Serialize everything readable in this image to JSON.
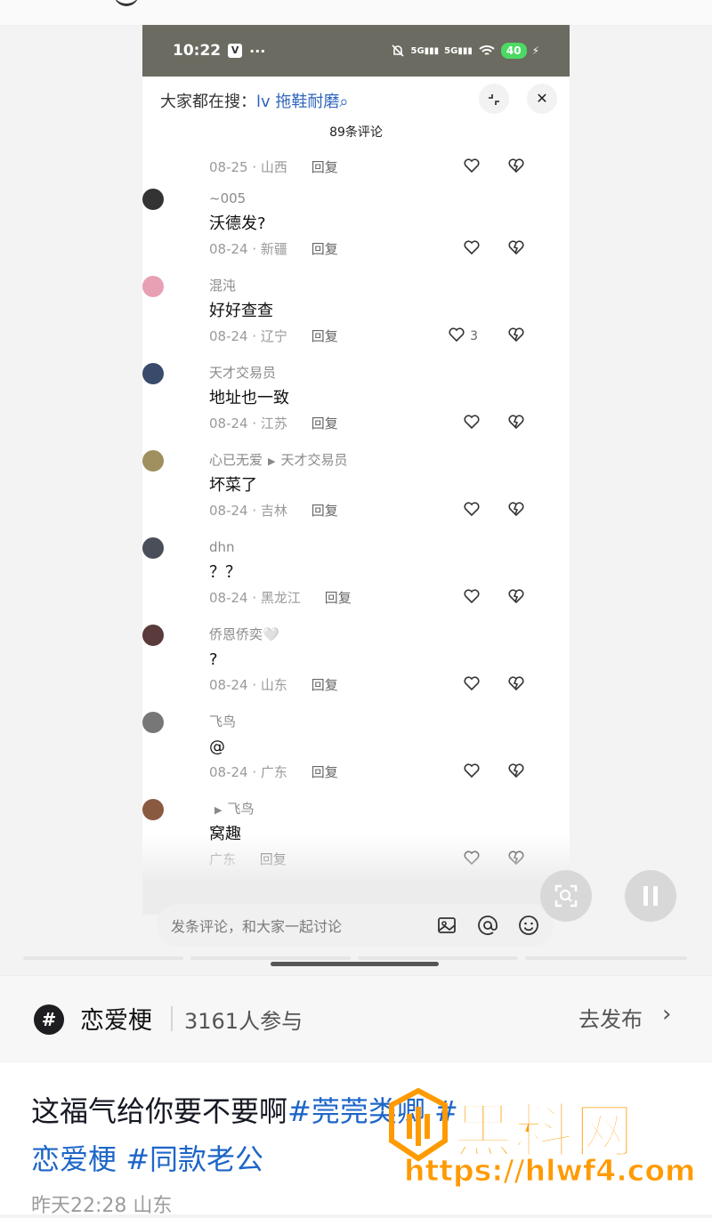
{
  "status_bar": {
    "time": "10:22",
    "app_badge": "V",
    "dots": "···",
    "network": "5G",
    "battery": "40"
  },
  "sheet": {
    "search_prefix": "大家都在搜：",
    "search_keyword": "lv 拖鞋耐磨",
    "comment_count_title": "89条评论"
  },
  "comments": [
    {
      "user": "",
      "text": "",
      "date": "08-25",
      "region": "山西",
      "reply": "回复",
      "likes": ""
    },
    {
      "user": "~005",
      "text": "沃德发?",
      "date": "08-24",
      "region": "新疆",
      "reply": "回复",
      "likes": ""
    },
    {
      "user": "混沌",
      "text": "好好查查",
      "date": "08-24",
      "region": "辽宁",
      "reply": "回复",
      "likes": "3"
    },
    {
      "user": "天才交易员",
      "text": "地址也一致",
      "date": "08-24",
      "region": "江苏",
      "reply": "回复",
      "likes": ""
    },
    {
      "user": "心已无爱",
      "reply_to": "天才交易员",
      "text": "坏菜了",
      "date": "08-24",
      "region": "吉林",
      "reply": "回复",
      "likes": ""
    },
    {
      "user": "dhn",
      "text": "？？",
      "date": "08-24",
      "region": "黑龙江",
      "reply": "回复",
      "likes": ""
    },
    {
      "user": "侨恩侨奕🤍",
      "text": "?",
      "date": "08-24",
      "region": "山东",
      "reply": "回复",
      "likes": ""
    },
    {
      "user": "飞鸟",
      "text": "@",
      "date": "08-24",
      "region": "广东",
      "reply": "回复",
      "likes": ""
    },
    {
      "user": "",
      "reply_to": "飞鸟",
      "text": "窝趣",
      "date": "",
      "region": "广东",
      "reply": "回复",
      "likes": ""
    }
  ],
  "input_bar": {
    "placeholder": "发条评论，和大家一起讨论"
  },
  "topic": {
    "name": "恋爱梗",
    "participants": "3161人参与",
    "action": "去发布"
  },
  "post": {
    "text_plain": "这福气给你要不要啊",
    "tag1": "#莞莞类卿",
    "tag2": "#",
    "tag3": "恋爱梗",
    "tag4": "#同款老公",
    "time": "昨天22:28 山东"
  },
  "watermark": {
    "title": "黑料网",
    "url": "https://hlwf4.com"
  },
  "colors": {
    "link": "#1e66c8",
    "watermark": "#ff9a00",
    "status_bg": "#6b6b61"
  }
}
